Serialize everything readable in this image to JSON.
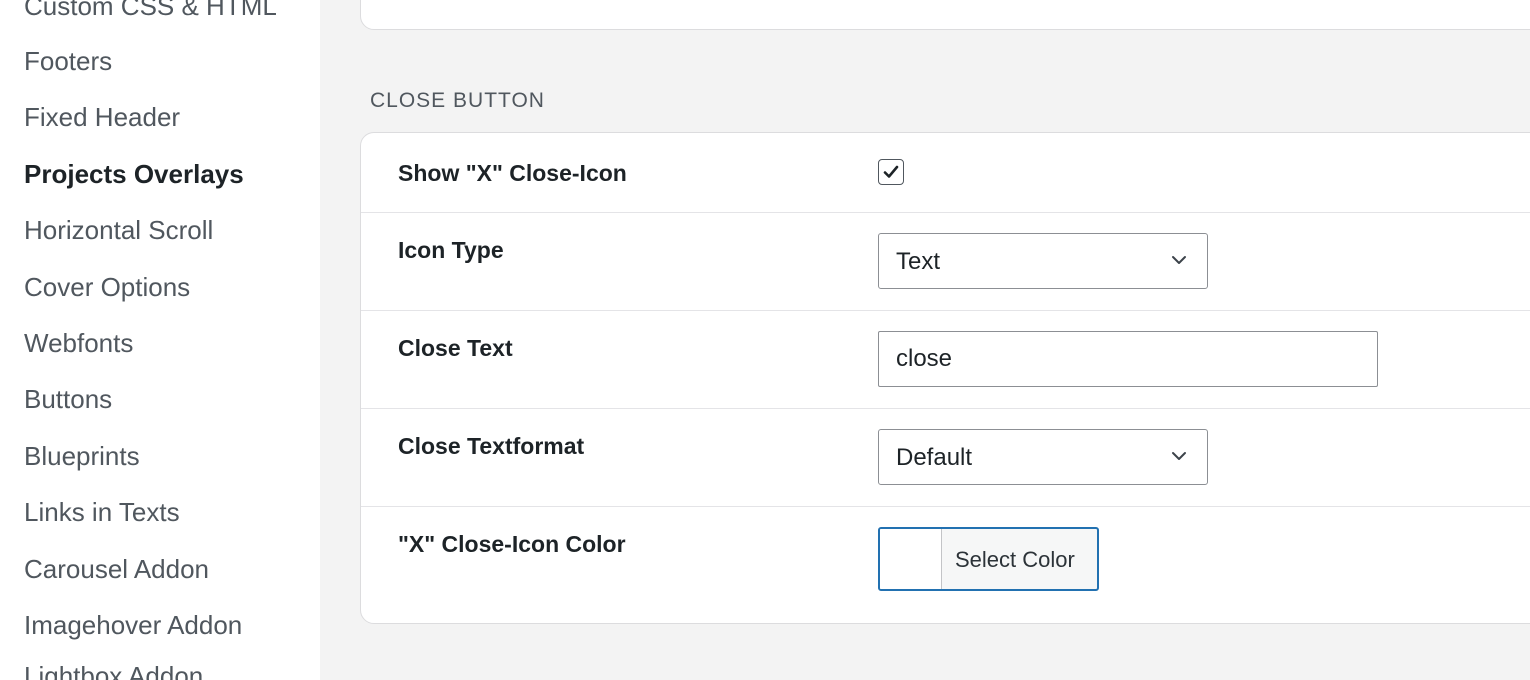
{
  "sidebar": {
    "items": [
      {
        "label": "Custom CSS & HTML",
        "active": false
      },
      {
        "label": "Footers",
        "active": false
      },
      {
        "label": "Fixed Header",
        "active": false
      },
      {
        "label": "Projects Overlays",
        "active": true
      },
      {
        "label": "Horizontal Scroll",
        "active": false
      },
      {
        "label": "Cover Options",
        "active": false
      },
      {
        "label": "Webfonts",
        "active": false
      },
      {
        "label": "Buttons",
        "active": false
      },
      {
        "label": "Blueprints",
        "active": false
      },
      {
        "label": "Links in Texts",
        "active": false
      },
      {
        "label": "Carousel Addon",
        "active": false
      },
      {
        "label": "Imagehover Addon",
        "active": false
      },
      {
        "label": "Lightbox Addon",
        "active": false
      }
    ]
  },
  "section": {
    "title": "CLOSE BUTTON"
  },
  "settings": {
    "show_icon": {
      "label": "Show \"X\" Close-Icon",
      "checked": true
    },
    "icon_type": {
      "label": "Icon Type",
      "value": "Text"
    },
    "close_text": {
      "label": "Close Text",
      "value": "close"
    },
    "close_textformat": {
      "label": "Close Textformat",
      "value": "Default"
    },
    "icon_color": {
      "label": "\"X\" Close-Icon Color",
      "button_label": "Select Color",
      "swatch_color": "#ffffff"
    }
  },
  "colors": {
    "accent": "#2271b1",
    "page_background": "#f3f3f3",
    "text": "#1d2327",
    "muted_text": "#50575e"
  }
}
